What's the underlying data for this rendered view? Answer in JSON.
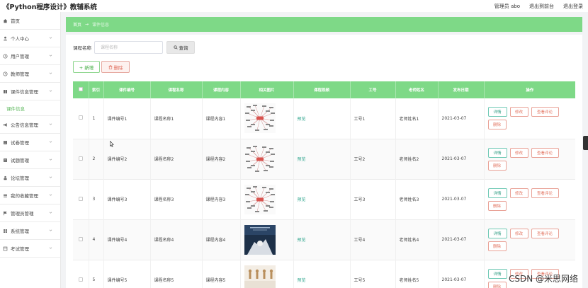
{
  "app": {
    "title": "《Python程序设计》教辅系统",
    "user_label": "管理员 abo",
    "back_front_label": "退出到前台",
    "logout_label": "退出登录"
  },
  "sidebar": {
    "items": [
      {
        "label": "首页",
        "icon": "home-icon"
      },
      {
        "label": "个人中心",
        "icon": "user-icon"
      },
      {
        "label": "用户管理",
        "icon": "clock-icon"
      },
      {
        "label": "教师管理",
        "icon": "clock-icon"
      },
      {
        "label": "课件信息管理",
        "icon": "book-icon",
        "expanded": true,
        "sub": "课件信息"
      },
      {
        "label": "公告信息管理",
        "icon": "megaphone-icon"
      },
      {
        "label": "试卷管理",
        "icon": "doc-icon"
      },
      {
        "label": "试题管理",
        "icon": "doc-icon"
      },
      {
        "label": "论坛管理",
        "icon": "person-icon"
      },
      {
        "label": "我的收藏管理",
        "icon": "list-icon"
      },
      {
        "label": "管理员管理",
        "icon": "flag-icon"
      },
      {
        "label": "系统管理",
        "icon": "grid-icon"
      },
      {
        "label": "考试管理",
        "icon": "box-icon"
      }
    ]
  },
  "breadcrumb": {
    "home": "首页",
    "sep": "→",
    "current": "课件信息"
  },
  "search": {
    "label": "课程名称",
    "placeholder": "课程名称",
    "button": "查询"
  },
  "actions": {
    "add": "+ 新增",
    "delete": "删除"
  },
  "table": {
    "headers": [
      "",
      "索引",
      "课件编号",
      "课程名称",
      "课程内容",
      "相关图片",
      "课程视频",
      "工号",
      "老师姓名",
      "发布日期",
      "操作"
    ],
    "preview_label": "预览",
    "ops": {
      "detail": "详情",
      "edit": "修改",
      "review": "查看评论",
      "delete": "删除"
    },
    "rows": [
      {
        "index": "1",
        "code": "课件编号1",
        "name": "课程名称1",
        "content": "课程内容1",
        "image": "mindmap",
        "job_no": "工号1",
        "teacher": "老师姓名1",
        "date": "2021-03-07"
      },
      {
        "index": "2",
        "code": "课件编号2",
        "name": "课程名称2",
        "content": "课程内容2",
        "image": "mindmap",
        "job_no": "工号2",
        "teacher": "老师姓名2",
        "date": "2021-03-07"
      },
      {
        "index": "3",
        "code": "课件编号3",
        "name": "课程名称3",
        "content": "课程内容3",
        "image": "mindmap",
        "job_no": "工号3",
        "teacher": "老师姓名3",
        "date": "2021-03-07"
      },
      {
        "index": "4",
        "code": "课件编号4",
        "name": "课程名称4",
        "content": "课程内容4",
        "image": "photo-dark",
        "job_no": "工号4",
        "teacher": "老师姓名4",
        "date": "2021-03-07"
      },
      {
        "index": "5",
        "code": "课件编号5",
        "name": "课程名称5",
        "content": "课程内容5",
        "image": "photo-figures",
        "job_no": "工号5",
        "teacher": "老师姓名5",
        "date": "2021-03-07"
      }
    ]
  },
  "watermark": "CSDN @米思网络",
  "colors": {
    "accent_green": "#7ed987",
    "link_teal": "#2fa58d",
    "danger": "#e2735f"
  }
}
